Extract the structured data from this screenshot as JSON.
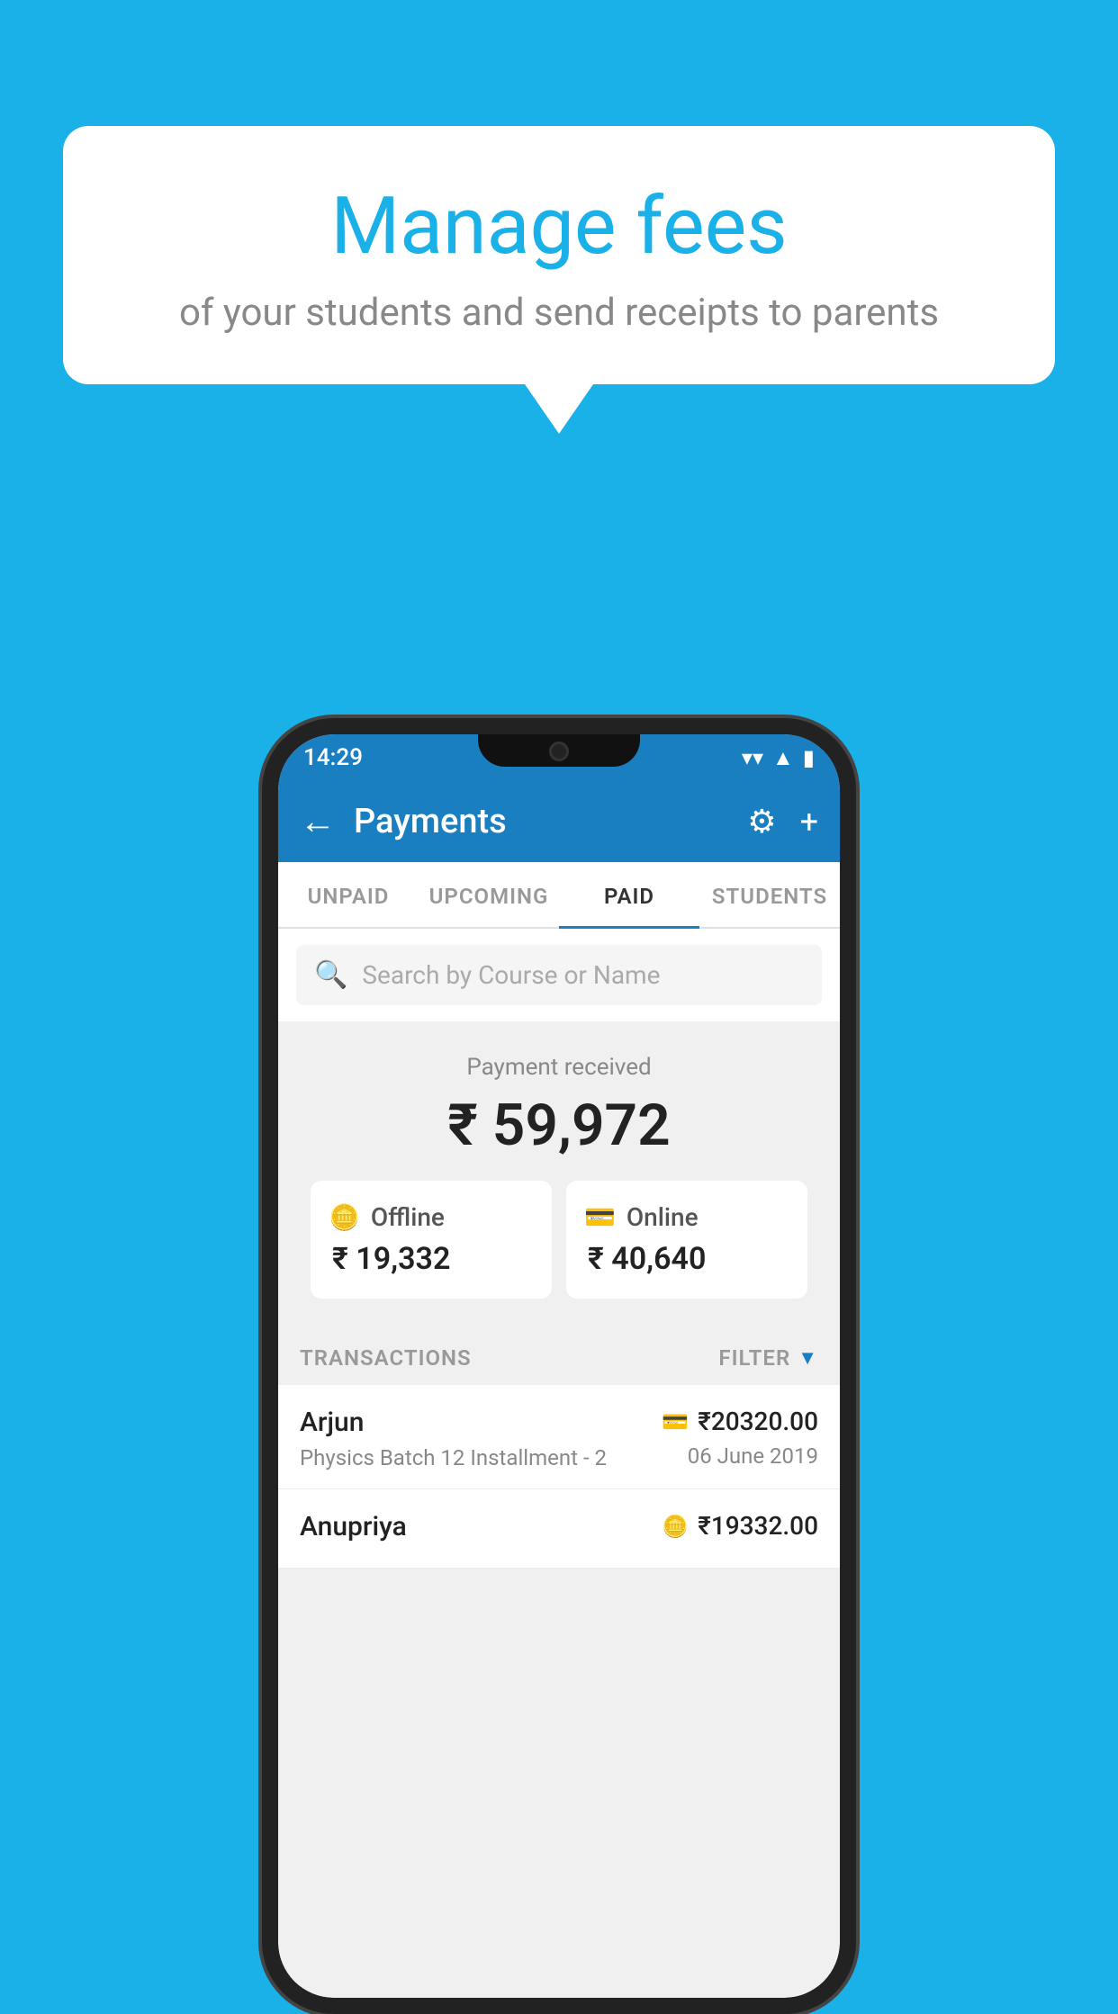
{
  "page": {
    "background_color": "#1ab0e8"
  },
  "speech_bubble": {
    "title": "Manage fees",
    "subtitle": "of your students and send receipts to parents"
  },
  "status_bar": {
    "time": "14:29",
    "wifi_icon": "▼",
    "signal_icon": "▲",
    "battery_icon": "▮"
  },
  "header": {
    "title": "Payments",
    "back_label": "←",
    "gear_label": "⚙",
    "plus_label": "+"
  },
  "tabs": [
    {
      "id": "unpaid",
      "label": "UNPAID",
      "active": false
    },
    {
      "id": "upcoming",
      "label": "UPCOMING",
      "active": false
    },
    {
      "id": "paid",
      "label": "PAID",
      "active": true
    },
    {
      "id": "students",
      "label": "STUDENTS",
      "active": false
    }
  ],
  "search": {
    "placeholder": "Search by Course or Name"
  },
  "payment_summary": {
    "label": "Payment received",
    "amount": "₹ 59,972",
    "offline": {
      "label": "Offline",
      "amount": "₹ 19,332"
    },
    "online": {
      "label": "Online",
      "amount": "₹ 40,640"
    }
  },
  "transactions": {
    "section_label": "TRANSACTIONS",
    "filter_label": "FILTER",
    "items": [
      {
        "name": "Arjun",
        "detail": "Physics Batch 12 Installment - 2",
        "amount": "₹20320.00",
        "date": "06 June 2019",
        "payment_type": "online"
      },
      {
        "name": "Anupriya",
        "detail": "",
        "amount": "₹19332.00",
        "date": "",
        "payment_type": "offline"
      }
    ]
  }
}
